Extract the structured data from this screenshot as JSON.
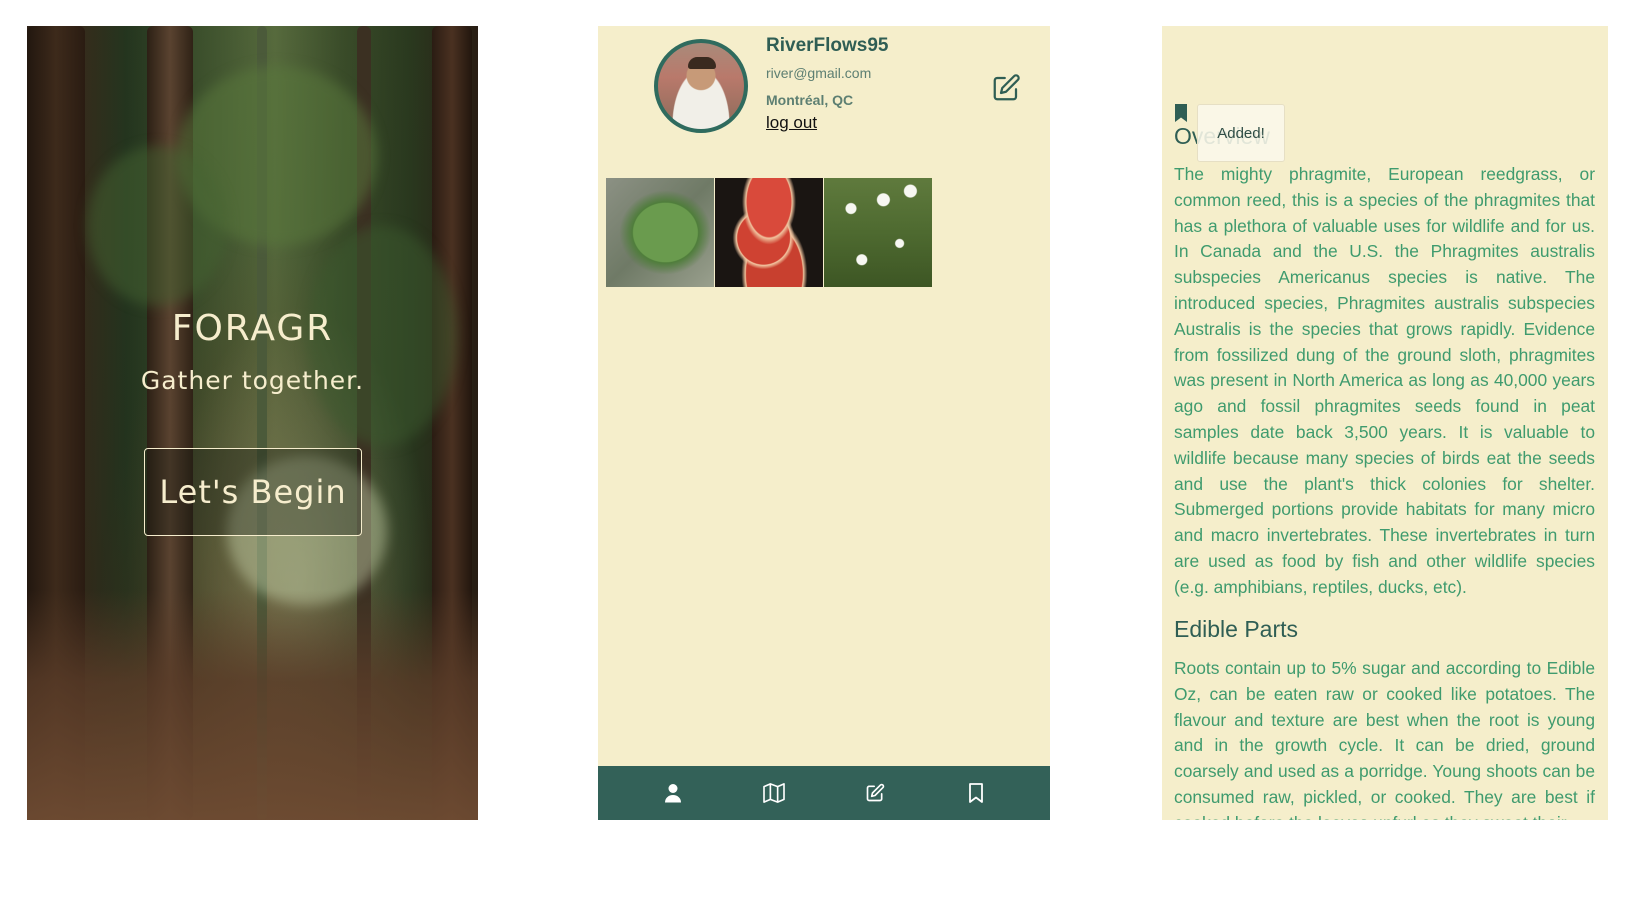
{
  "splash": {
    "title": "FORAGR",
    "tagline": "Gather together.",
    "begin_label": "Let's Begin"
  },
  "profile": {
    "username": "RiverFlows95",
    "email": "river@gmail.com",
    "location": "Montréal, QC",
    "logout_label": "log out",
    "photos": [
      "leaf-photo",
      "fungus-photo",
      "daisy-photo"
    ],
    "nav": [
      "user-icon",
      "map-icon",
      "edit-icon",
      "bookmark-icon"
    ]
  },
  "detail": {
    "overview_heading": "Overview",
    "toast": "Added!",
    "overview_text": "The mighty phragmite, European reedgrass, or common reed, this is a species of the phragmites that has a plethora of valuable uses for wildlife and for us. In Canada and the U.S. the Phragmites australis subspecies Americanus species is native. The introduced species, Phragmites australis subspecies Australis is the species that grows rapidly. Evidence from fossilized dung of the ground sloth, phragmites was present in North America as long as 40,000 years ago and fossil phragmites seeds found in peat samples date back 3,500 years. It is valuable to wildlife because many species of birds eat the seeds and use the plant's thick colonies for shelter. Submerged portions provide habitats for many micro and macro invertebrates. These invertebrates in turn are used as food by fish and other wildlife species (e.g. amphibians, reptiles, ducks, etc).",
    "edible_heading": "Edible Parts",
    "edible_text": "Roots contain up to 5% sugar and according to Edible Oz, can be eaten raw or cooked like potatoes. The flavour and texture are best when the root is young and in the growth cycle. It can be dried, ground coarsely and used as a porridge. Young shoots can be consumed raw, pickled, or cooked. They are best if cooked before the leaves unfurl as they sweet their"
  },
  "colors": {
    "cream": "#f5eecb",
    "teal": "#336158",
    "text_green": "#3f9b6e"
  }
}
